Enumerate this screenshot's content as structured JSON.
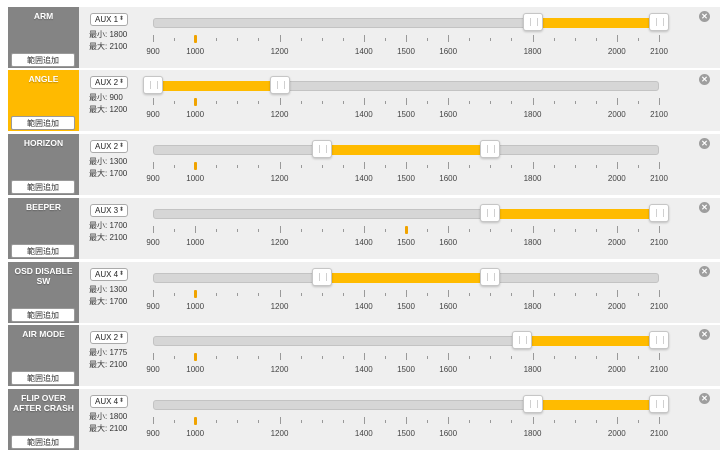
{
  "add_range_label": "範囲追加",
  "min_prefix": "最小: ",
  "max_prefix": "最大: ",
  "select_arrows": "▲▼",
  "remove_glyph": "✕",
  "scale": {
    "ticks": [
      900,
      1000,
      1200,
      1400,
      1500,
      1600,
      1800,
      2000,
      2100
    ],
    "labels": [
      "900",
      "1000",
      "1200",
      "1400",
      "1500",
      "1600",
      "1800",
      "2000",
      "2100"
    ]
  },
  "colors": {
    "active_mode": "#ffba00",
    "inactive_mode": "#848484",
    "range_fill": "#ffbb00"
  },
  "modes": [
    {
      "name": "ARM",
      "aux": "AUX 1",
      "min": 1800,
      "max": 2100,
      "channel": 1000,
      "active": false
    },
    {
      "name": "ANGLE",
      "aux": "AUX 2",
      "min": 900,
      "max": 1200,
      "channel": 1000,
      "active": true
    },
    {
      "name": "HORIZON",
      "aux": "AUX 2",
      "min": 1300,
      "max": 1700,
      "channel": 1000,
      "active": false
    },
    {
      "name": "BEEPER",
      "aux": "AUX 3",
      "min": 1700,
      "max": 2100,
      "channel": 1500,
      "active": false
    },
    {
      "name": "OSD DISABLE SW",
      "aux": "AUX 4",
      "min": 1300,
      "max": 1700,
      "channel": 1000,
      "active": false
    },
    {
      "name": "AIR MODE",
      "aux": "AUX 2",
      "min": 1775,
      "max": 2100,
      "channel": 1000,
      "active": false
    },
    {
      "name": "FLIP OVER AFTER CRASH",
      "aux": "AUX 4",
      "min": 1800,
      "max": 2100,
      "channel": 1000,
      "active": false
    }
  ]
}
